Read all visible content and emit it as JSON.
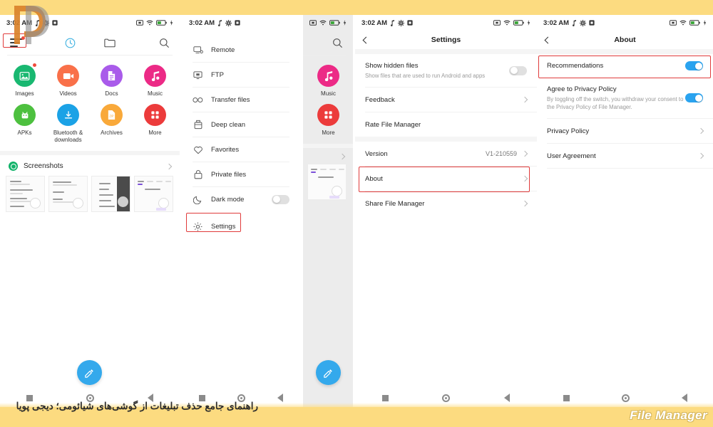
{
  "caption": {
    "persian": "راهنمای جامع حذف تبلیغات از گوشی‌های شیائومی؛ دیجی پویا",
    "watermark": "File Manager"
  },
  "colors": {
    "band": "#fcdb80",
    "accent_blue": "#2aa3ef",
    "highlight_red": "#e03b3b",
    "fab": "#34a9ec"
  },
  "status_bar": {
    "time": "3:02 AM",
    "left_icons": [
      "music-note-icon",
      "gear-icon",
      "screenshot-icon"
    ],
    "right_icons": [
      "alarm-icon",
      "wifi-icon",
      "battery-icon",
      "signal-icon"
    ]
  },
  "panel1": {
    "name": "file-manager-home",
    "toolbar": {
      "menu_icon": "hamburger-menu-icon",
      "recent_icon": "clock-history-icon",
      "folder_icon": "folder-icon",
      "search_icon": "search-icon"
    },
    "categories": [
      {
        "label": "Images",
        "icon": "image-icon",
        "color": "#19b871",
        "badge": true
      },
      {
        "label": "Videos",
        "icon": "video-icon",
        "color": "#f97049",
        "badge": false
      },
      {
        "label": "Docs",
        "icon": "document-icon",
        "color": "#a95bea",
        "badge": false
      },
      {
        "label": "Music",
        "icon": "music-icon",
        "color": "#ec2a86",
        "badge": false
      },
      {
        "label": "APKs",
        "icon": "android-icon",
        "color": "#4dc03f",
        "badge": false
      },
      {
        "label": "Bluetooth &\ndownloads",
        "icon": "download-icon",
        "color": "#1ba2e6",
        "badge": false
      },
      {
        "label": "Archives",
        "icon": "zip-icon",
        "color": "#f9a93a",
        "badge": false
      },
      {
        "label": "More",
        "icon": "grid-more-icon",
        "color": "#ec3b3b",
        "badge": false
      }
    ],
    "screenshots_section": {
      "title": "Screenshots",
      "chevron": "chevron-right-icon",
      "thumbnail_count": 4
    },
    "fab_icon": "clean-broom-icon",
    "highlight": "hamburger-menu-icon"
  },
  "panel2": {
    "name": "file-manager-drawer",
    "items": [
      {
        "label": "Remote",
        "icon": "remote-screen-icon",
        "type": "link"
      },
      {
        "label": "FTP",
        "icon": "ftp-monitor-icon",
        "type": "link"
      },
      {
        "label": "Transfer files",
        "icon": "transfer-link-icon",
        "type": "link"
      },
      {
        "label": "Deep clean",
        "icon": "deep-clean-icon",
        "type": "link"
      },
      {
        "label": "Favorites",
        "icon": "heart-icon",
        "type": "link"
      },
      {
        "label": "Private files",
        "icon": "lock-icon",
        "type": "link"
      },
      {
        "label": "Dark mode",
        "icon": "moon-icon",
        "type": "toggle",
        "toggle_on": false
      },
      {
        "label": "Settings",
        "icon": "gear-icon",
        "type": "link",
        "highlighted": true
      }
    ]
  },
  "panel3": {
    "name": "settings-screen",
    "appbar": {
      "title": "Settings",
      "back_icon": "back-chevron-icon"
    },
    "rows": [
      {
        "title": "Show hidden files",
        "subtitle": "Show files that are used to run Android and apps",
        "type": "toggle",
        "toggle_on": false
      },
      {
        "title": "Feedback",
        "subtitle": "",
        "type": "link",
        "chevron": true
      },
      {
        "title": "Rate File Manager",
        "subtitle": "",
        "type": "link",
        "chevron": false
      },
      {
        "title": "Version",
        "subtitle": "",
        "type": "value",
        "value": "V1-210559",
        "chevron": true
      },
      {
        "title": "About",
        "subtitle": "",
        "type": "link",
        "chevron": true,
        "highlighted": true
      },
      {
        "title": "Share File Manager",
        "subtitle": "",
        "type": "link",
        "chevron": true
      }
    ]
  },
  "panel4": {
    "name": "about-screen",
    "appbar": {
      "title": "About",
      "back_icon": "back-chevron-icon"
    },
    "rows": [
      {
        "title": "Recommendations",
        "subtitle": "",
        "type": "toggle",
        "toggle_on": true,
        "highlighted": true
      },
      {
        "title": "Agree to Privacy Policy",
        "subtitle": "By toggling off the switch, you withdraw your consent to the Privacy Policy of File Manager.",
        "type": "toggle",
        "toggle_on": true
      },
      {
        "title": "Privacy Policy",
        "subtitle": "",
        "type": "link",
        "chevron": true
      },
      {
        "title": "User Agreement",
        "subtitle": "",
        "type": "link",
        "chevron": true
      }
    ]
  }
}
